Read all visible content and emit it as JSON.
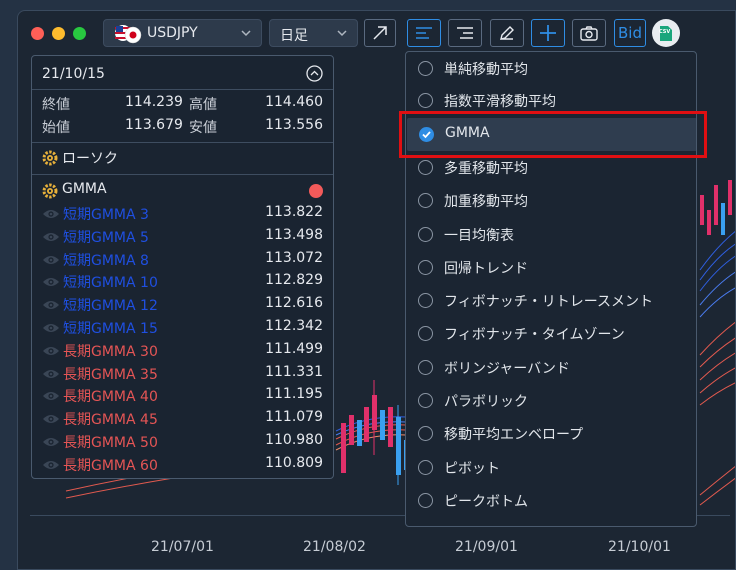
{
  "toolbar": {
    "symbol": "USDJPY",
    "timeframe": "日足",
    "bid_label": "Bid",
    "csv_label": "CSV"
  },
  "colors": {
    "accent": "#2f8de4",
    "short_gmma": "#1f4fe0",
    "long_gmma": "#e45555",
    "highlight": "#e00f12"
  },
  "info_panel": {
    "date": "21/10/15",
    "ohlc": [
      {
        "label_a": "終値",
        "value_a": "114.239",
        "label_b": "高値",
        "value_b": "114.460"
      },
      {
        "label_a": "始値",
        "value_a": "113.679",
        "label_b": "安値",
        "value_b": "113.556"
      }
    ],
    "candles_label": "ローソク",
    "gmma_label": "GMMA",
    "gmma_rows": [
      {
        "name": "短期GMMA 3",
        "value": "113.822",
        "group": "short"
      },
      {
        "name": "短期GMMA 5",
        "value": "113.498",
        "group": "short"
      },
      {
        "name": "短期GMMA 8",
        "value": "113.072",
        "group": "short"
      },
      {
        "name": "短期GMMA 10",
        "value": "112.829",
        "group": "short"
      },
      {
        "name": "短期GMMA 12",
        "value": "112.616",
        "group": "short"
      },
      {
        "name": "短期GMMA 15",
        "value": "112.342",
        "group": "short"
      },
      {
        "name": "長期GMMA 30",
        "value": "111.499",
        "group": "long"
      },
      {
        "name": "長期GMMA 35",
        "value": "111.331",
        "group": "long"
      },
      {
        "name": "長期GMMA 40",
        "value": "111.195",
        "group": "long"
      },
      {
        "name": "長期GMMA 45",
        "value": "111.079",
        "group": "long"
      },
      {
        "name": "長期GMMA 50",
        "value": "110.980",
        "group": "long"
      },
      {
        "name": "長期GMMA 60",
        "value": "110.809",
        "group": "long"
      }
    ]
  },
  "indicator_menu": {
    "items": [
      {
        "label": "単純移動平均",
        "selected": false
      },
      {
        "label": "指数平滑移動平均",
        "selected": false
      },
      {
        "label": "GMMA",
        "selected": true
      },
      {
        "label": "多重移動平均",
        "selected": false
      },
      {
        "label": "加重移動平均",
        "selected": false
      },
      {
        "label": "一目均衡表",
        "selected": false
      },
      {
        "label": "回帰トレンド",
        "selected": false
      },
      {
        "label": "フィボナッチ・リトレースメント",
        "selected": false
      },
      {
        "label": "フィボナッチ・タイムゾーン",
        "selected": false
      },
      {
        "label": "ボリンジャーバンド",
        "selected": false
      },
      {
        "label": "パラボリック",
        "selected": false
      },
      {
        "label": "移動平均エンベロープ",
        "selected": false
      },
      {
        "label": "ピボット",
        "selected": false
      },
      {
        "label": "ピークボトム",
        "selected": false
      }
    ]
  },
  "x_axis": {
    "ticks": [
      "21/07/01",
      "21/08/02",
      "21/09/01",
      "21/10/01"
    ]
  }
}
